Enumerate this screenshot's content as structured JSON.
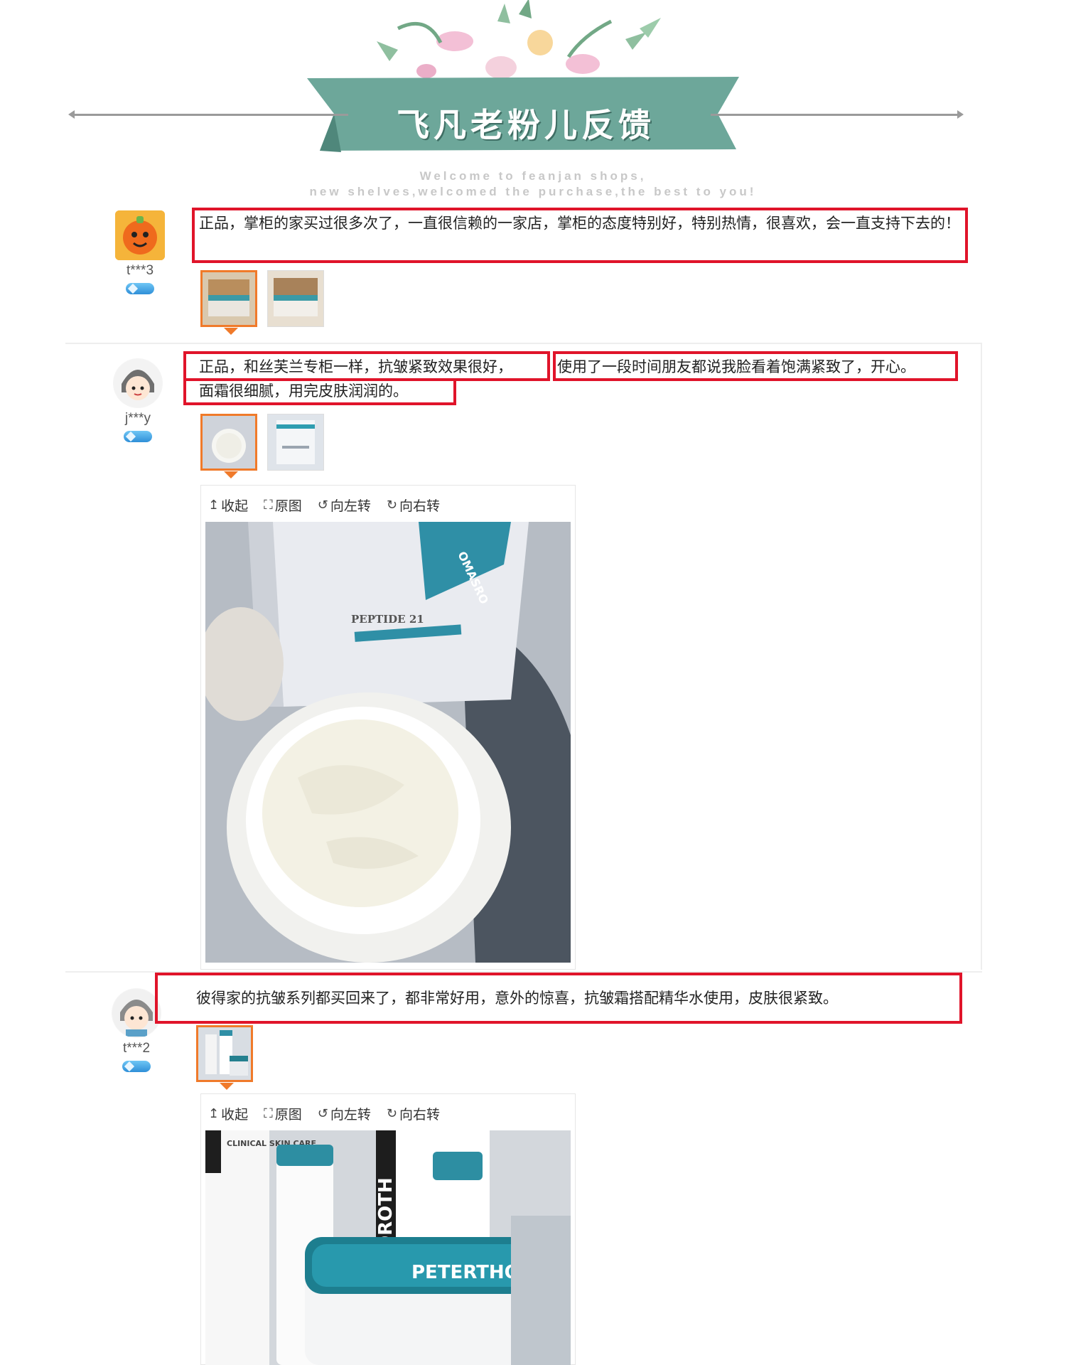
{
  "banner": {
    "title": "飞凡老粉儿反馈",
    "subtitle_line1": "Welcome to feanjan shops,",
    "subtitle_line2": "new shelves,welcomed the purchase,the best to you!"
  },
  "reviews": [
    {
      "user": "t***3",
      "comment": "正品，掌柜的家买过很多次了，一直很信赖的一家店，掌柜的态度特别好，特别热情，很喜欢，会一直支持下去的！",
      "thumbs": [
        "thumb-1",
        "thumb-2"
      ]
    },
    {
      "user": "j***y",
      "comment_part1": "正品，和丝芙兰专柜一样，抗皱紧致效果很好，",
      "comment_part2": "使用了一段时间朋友都说我脸看着饱满紧致了，开心。",
      "comment_part3": "面霜很细腻，用完皮肤润润的。",
      "thumbs": [
        "thumb-1",
        "thumb-2"
      ],
      "viewer": {
        "collapse": "收起",
        "original": "原图",
        "rotate_left": "向左转",
        "rotate_right": "向右转",
        "box_brand_text": "PEPTIDE 21",
        "box_side_text": "OMASRO"
      }
    },
    {
      "user": "t***2",
      "comment": "彼得家的抗皱系列都买回来了，都非常好用，意外的惊喜，抗皱霜搭配精华水使用，皮肤很紧致。",
      "thumbs": [
        "thumb-1"
      ],
      "viewer": {
        "collapse": "收起",
        "original": "原图",
        "rotate_left": "向左转",
        "rotate_right": "向右转",
        "brand_text": "PETERTHOM",
        "side_text": "OROTH",
        "clinical_text": "CLINICAL SKIN CARE"
      }
    }
  ],
  "colors": {
    "highlight_border": "#e0142a",
    "selected_thumb": "#f07a2a",
    "ribbon": "#6da79a"
  }
}
